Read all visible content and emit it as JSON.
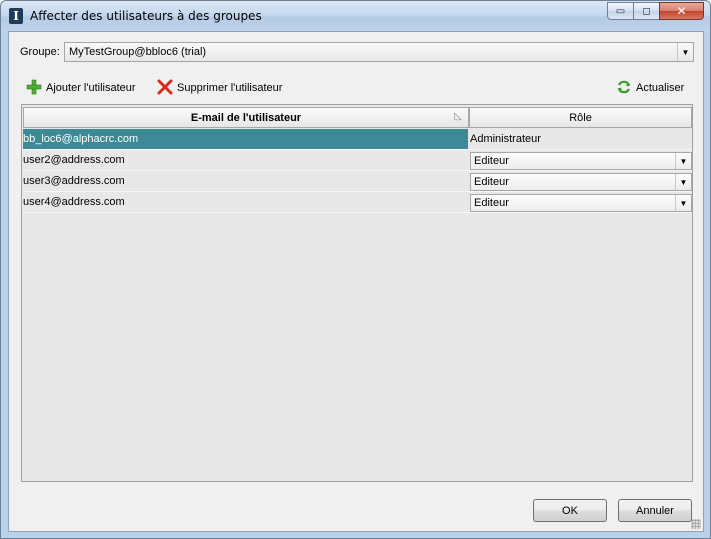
{
  "window": {
    "title": "Affecter des utilisateurs à des groupes",
    "app_icon_glyph": "I",
    "buttons": {
      "minimize": "▭",
      "maximize": "◻",
      "close": "✕"
    }
  },
  "group": {
    "label": "Groupe:",
    "selected": "MyTestGroup@bbloc6 (trial)"
  },
  "toolbar": {
    "add_label": "Ajouter l'utilisateur",
    "remove_label": "Supprimer l'utilisateur",
    "refresh_label": "Actualiser",
    "icons": {
      "add": "plus-icon",
      "remove": "cross-icon",
      "refresh": "refresh-icon"
    }
  },
  "table": {
    "columns": {
      "email": "E-mail de l'utilisateur",
      "role": "Rôle"
    },
    "rows": [
      {
        "email": "bb_loc6@alphacrc.com",
        "role": "Administrateur",
        "editable": false,
        "selected": true
      },
      {
        "email": "user2@address.com",
        "role": "Editeur",
        "editable": true,
        "selected": false
      },
      {
        "email": "user3@address.com",
        "role": "Editeur",
        "editable": true,
        "selected": false
      },
      {
        "email": "user4@address.com",
        "role": "Editeur",
        "editable": true,
        "selected": false
      }
    ]
  },
  "footer": {
    "ok_label": "OK",
    "cancel_label": "Annuler"
  },
  "colors": {
    "selection": "#3b8a96",
    "add_icon": "#4caf2f",
    "remove_icon": "#d42a20",
    "refresh_icon": "#3a9a2a"
  }
}
